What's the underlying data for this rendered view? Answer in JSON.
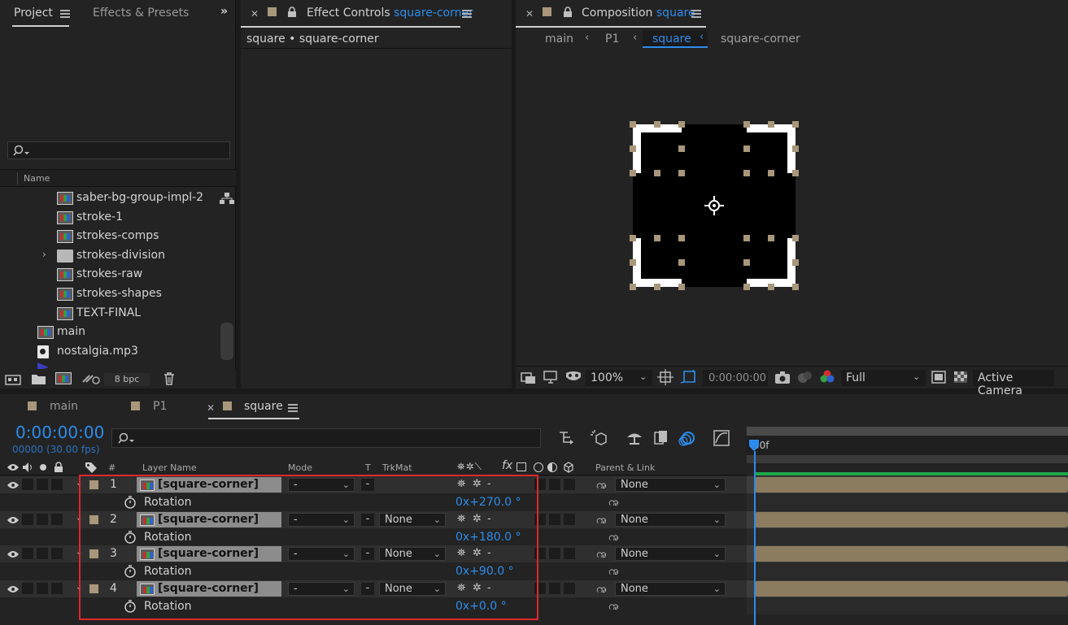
{
  "project_panel": {
    "tab_label": "Project",
    "effects_tab": "Effects & Presets",
    "name_column": "Name",
    "items": [
      {
        "label": "saber-bg-group-impl-2",
        "type": "comp",
        "indent": 1
      },
      {
        "label": "stroke-1",
        "type": "comp",
        "indent": 1
      },
      {
        "label": "strokes-comps",
        "type": "comp",
        "indent": 1
      },
      {
        "label": "strokes-division",
        "type": "folder",
        "indent": 1
      },
      {
        "label": "strokes-raw",
        "type": "comp",
        "indent": 1
      },
      {
        "label": "strokes-shapes",
        "type": "comp",
        "indent": 1
      },
      {
        "label": "TEXT-FINAL",
        "type": "comp",
        "indent": 1
      },
      {
        "label": "main",
        "type": "comp",
        "indent": 0
      },
      {
        "label": "nostalgia.mp3",
        "type": "audio",
        "indent": 0
      }
    ],
    "bpc": "8 bpc"
  },
  "effect_controls": {
    "title": "Effect Controls",
    "layer": "square-corner",
    "subtitle": "square • square-corner"
  },
  "composition": {
    "title": "Composition",
    "name": "square",
    "breadcrumbs": [
      "main",
      "P1",
      "square",
      "square-corner"
    ],
    "zoom": "100%",
    "timecode": "0:00:00:00",
    "resolution": "Full",
    "camera": "Active Camera"
  },
  "timeline": {
    "tabs": [
      "main",
      "P1",
      "square"
    ],
    "timecode": "0:00:00:00",
    "frames": "00000 (30.00 fps)",
    "ruler_label": "00f",
    "columns": {
      "num": "#",
      "layer_name": "Layer Name",
      "mode": "Mode",
      "t": "T",
      "trkmat": "TrkMat",
      "parent": "Parent & Link"
    },
    "layers": [
      {
        "num": "1",
        "name": "[square-corner]",
        "mode": "-",
        "trkmat": "",
        "parent": "None",
        "prop": "Rotation",
        "value_turns": "0x",
        "value_deg": "+270.0",
        "unit": "°"
      },
      {
        "num": "2",
        "name": "[square-corner]",
        "mode": "-",
        "trkmat": "None",
        "parent": "None",
        "prop": "Rotation",
        "value_turns": "0x",
        "value_deg": "+180.0",
        "unit": "°"
      },
      {
        "num": "3",
        "name": "[square-corner]",
        "mode": "-",
        "trkmat": "None",
        "parent": "None",
        "prop": "Rotation",
        "value_turns": "0x",
        "value_deg": "+90.0",
        "unit": "°"
      },
      {
        "num": "4",
        "name": "[square-corner]",
        "mode": "-",
        "trkmat": "None",
        "parent": "None",
        "prop": "Rotation",
        "value_turns": "0x",
        "value_deg": "+0.0",
        "unit": "°"
      }
    ]
  },
  "colors": {
    "accent": "#2d8ceb",
    "label_swatch": "#a8977a",
    "highlight_box": "#e0282c",
    "layer_bar": "#8c7c5f"
  }
}
